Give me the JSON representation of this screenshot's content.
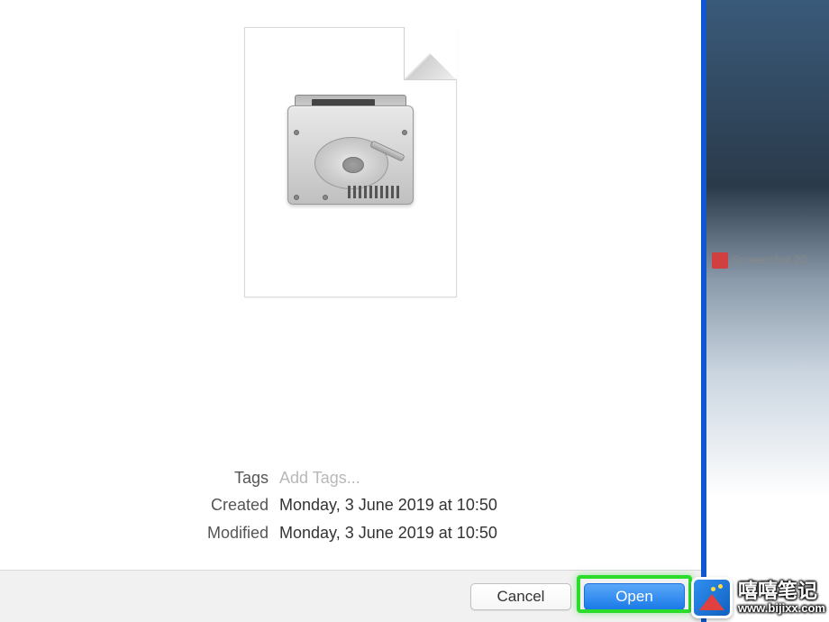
{
  "metadata": {
    "tags_label": "Tags",
    "tags_placeholder": "Add Tags...",
    "created_label": "Created",
    "created_value": "Monday, 3 June 2019 at 10:50",
    "modified_label": "Modified",
    "modified_value": "Monday, 3 June 2019 at 10:50"
  },
  "buttons": {
    "cancel": "Cancel",
    "open": "Open"
  },
  "background": {
    "file_label": "Screenshot 20..."
  },
  "watermark": {
    "title": "嘻嘻笔记",
    "url": "www.bijixx.com"
  }
}
